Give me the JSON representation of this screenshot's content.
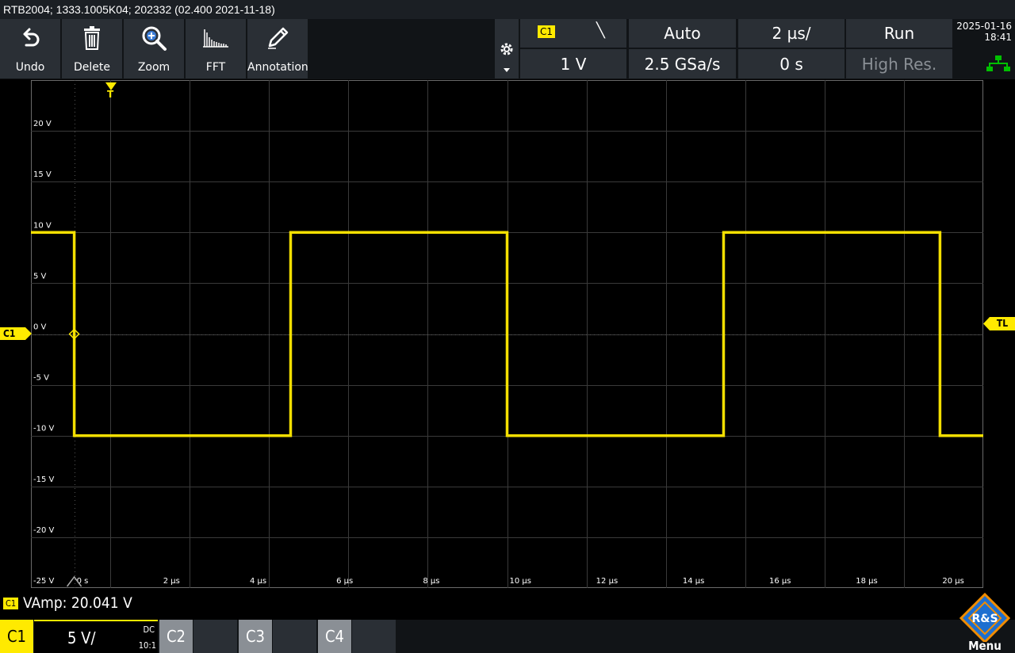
{
  "titlebar": {
    "text": "RTB2004; 1333.1005K04; 202332 (02.400 2021-11-18)"
  },
  "toolbar": {
    "buttons": [
      {
        "label": "Undo",
        "icon": "undo-icon"
      },
      {
        "label": "Delete",
        "icon": "trash-icon"
      },
      {
        "label": "Zoom",
        "icon": "zoom-icon"
      },
      {
        "label": "FFT",
        "icon": "fft-icon"
      },
      {
        "label": "Annotation",
        "icon": "pencil-icon"
      }
    ]
  },
  "status": {
    "trigger_source": "C1",
    "trigger_edge": "╲",
    "trigger_mode": "Auto",
    "timebase": "2 µs/",
    "run_state": "Run",
    "trigger_level": "1 V",
    "sample_rate": "2.5 GSa/s",
    "horizontal_position": "0 s",
    "acquisition_mode": "High Res."
  },
  "clock": {
    "date": "2025-01-16",
    "time": "18:41"
  },
  "channel_marker": "C1",
  "trigger_level_marker": "TL",
  "trigger_marker": "T",
  "y_ticks": [
    "20 V",
    "15 V",
    "10 V",
    "5 V",
    "0 V",
    "-5 V",
    "-10 V",
    "-15 V",
    "-20 V",
    "-25 V"
  ],
  "x_ticks": [
    "0 s",
    "2 µs",
    "4 µs",
    "6 µs",
    "8 µs",
    "10 µs",
    "12 µs",
    "14 µs",
    "16 µs",
    "18 µs",
    "20 µs"
  ],
  "measurement": {
    "channel": "C1",
    "text": "VAmp: 20.041 V"
  },
  "channels": [
    {
      "name": "C1",
      "scale": "5 V/",
      "coupling": "DC",
      "probe": "10:1",
      "active": true
    },
    {
      "name": "C2"
    },
    {
      "name": "C3"
    },
    {
      "name": "C4"
    }
  ],
  "menu_label": "Menu",
  "logo_text": "R&S",
  "colors": {
    "trace": "#ffea00",
    "grid": "#3a3a3a",
    "panel": "#2a2f35"
  },
  "chart_data": {
    "type": "line",
    "xlabel": "",
    "ylabel": "",
    "x_unit": "µs",
    "y_unit": "V",
    "xlim": [
      -1,
      21
    ],
    "ylim": [
      -25,
      25
    ],
    "grid": true,
    "series": [
      {
        "x": [
          -1,
          0,
          0,
          5,
          5,
          10,
          10,
          15,
          15,
          20,
          20,
          21
        ],
        "y": [
          10,
          10,
          -10,
          -10,
          10,
          10,
          -10,
          -10,
          10,
          10,
          -10,
          -10
        ]
      }
    ]
  }
}
